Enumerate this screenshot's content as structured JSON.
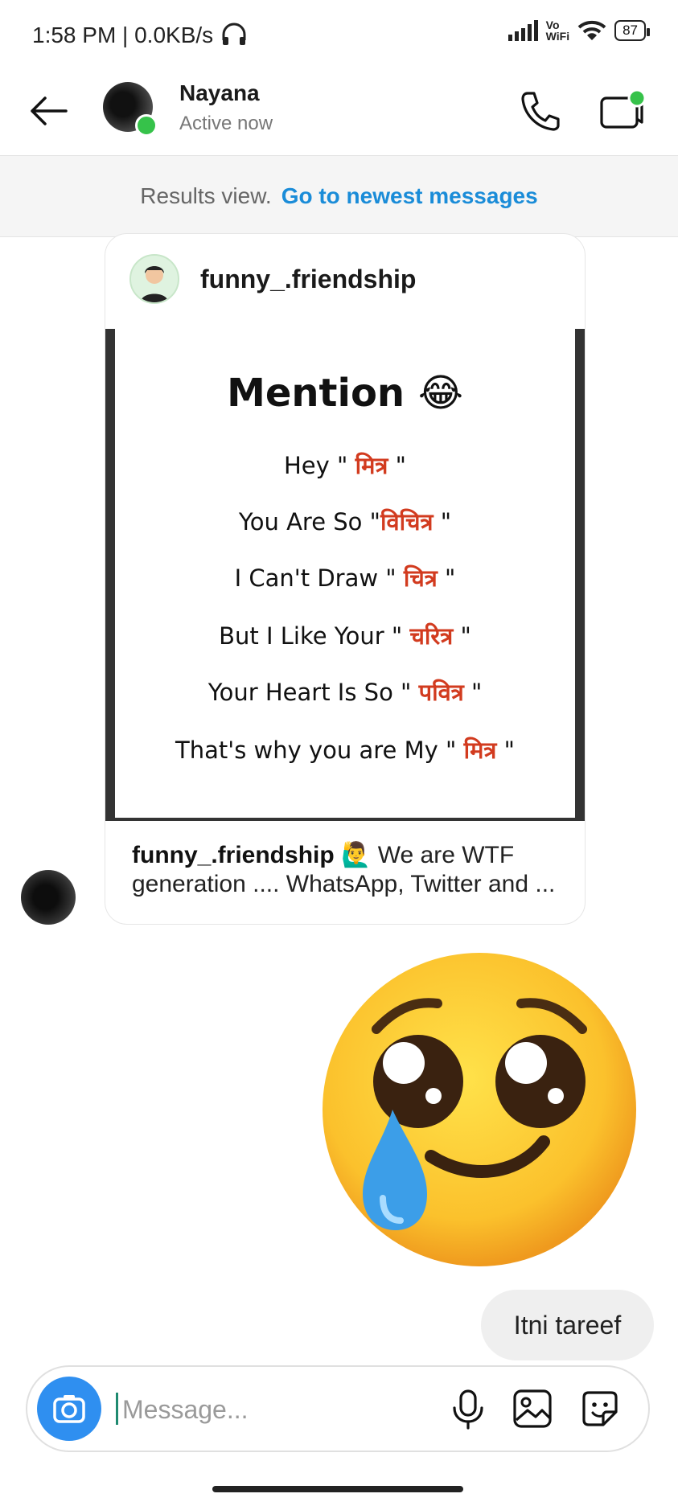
{
  "status_bar": {
    "time": "1:58 PM | 0.0KB/s",
    "network_icon": "headphones-icon",
    "signal": "signal-icon",
    "vowifi_top": "Vo",
    "vowifi_bottom": "WiFi",
    "battery": "87"
  },
  "header": {
    "name": "Nayana",
    "status": "Active now",
    "back_icon": "arrow-left-icon",
    "call_icon": "phone-icon",
    "video_icon": "video-camera-icon"
  },
  "results": {
    "label": "Results view.",
    "link": "Go to newest messages"
  },
  "post": {
    "username": "funny_.friendship",
    "image": {
      "title": "Mention",
      "title_emoji": "😂",
      "lines": [
        {
          "text": "Hey \"",
          "hindi": "मित्र",
          "end": "\""
        },
        {
          "text": "You Are So \"",
          "hindi": "विचित्र",
          "end": "\""
        },
        {
          "text": "I Can't Draw \"",
          "hindi": "चित्र",
          "end": "\""
        },
        {
          "text": "But I Like Your \"",
          "hindi": "चरित्र",
          "end": "\""
        },
        {
          "text": "Your Heart Is So \"",
          "hindi": "पवित्र",
          "end": "\""
        },
        {
          "text": "That's why you are My \"",
          "hindi": "मित्र",
          "end": "\""
        }
      ]
    },
    "caption_user": "funny_.friendship",
    "caption_emoji": "🙋‍♂️",
    "caption_text": "We are WTF generation .... WhatsApp, Twitter and ..."
  },
  "messages": {
    "sent_emoji": "pleading-crying-face-emoji",
    "sent_text": "Itni tareef"
  },
  "composer": {
    "placeholder": "Message...",
    "camera_icon": "camera-icon",
    "mic_icon": "microphone-icon",
    "gallery_icon": "image-icon",
    "sticker_icon": "sticker-icon"
  },
  "colors": {
    "link": "#1a8cd8",
    "online": "#36c24a",
    "camera": "#2f8ff0",
    "hindi_text": "#d23b1f"
  }
}
